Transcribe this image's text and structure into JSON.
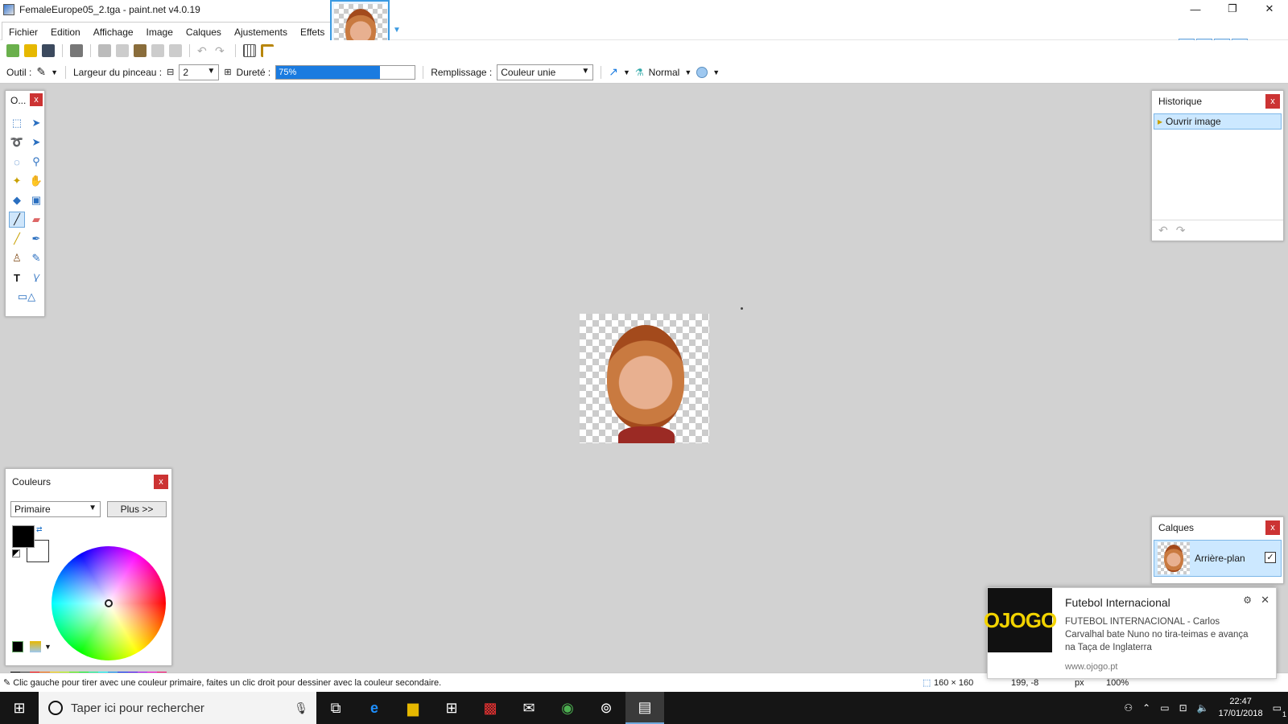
{
  "window": {
    "title": "FemaleEurope05_2.tga - paint.net v4.0.19",
    "minimize": "—",
    "restore": "❐",
    "close": "✕"
  },
  "menu": [
    "Fichier",
    "Edition",
    "Affichage",
    "Image",
    "Calques",
    "Ajustements",
    "Effets"
  ],
  "toolbar2": {
    "tool_label": "Outil :",
    "brush_width_label": "Largeur du pinceau :",
    "brush_width_value": "2",
    "hardness_label": "Dureté :",
    "hardness_value": "75%",
    "hardness_fraction": 0.75,
    "fill_label": "Remplissage :",
    "fill_value": "Couleur unie",
    "blend_mode": "Normal"
  },
  "tools_panel": {
    "title": "O...",
    "close": "x"
  },
  "history": {
    "title": "Historique",
    "close": "x",
    "items": [
      "Ouvrir image"
    ]
  },
  "layers": {
    "title": "Calques",
    "close": "x",
    "items": [
      {
        "name": "Arrière-plan",
        "visible_check": "✓"
      }
    ]
  },
  "colors": {
    "title": "Couleurs",
    "close": "x",
    "mode": "Primaire",
    "more_button": "Plus >>"
  },
  "status": {
    "hint": "Clic gauche pour tirer avec une couleur primaire, faites un clic droit pour dessiner avec la couleur secondaire.",
    "image_size": "160 × 160",
    "cursor_pos": "199, -8",
    "units": "px",
    "zoom": "100%"
  },
  "toast": {
    "logo": "OJOGO",
    "title": "Futebol Internacional",
    "body": "FUTEBOL INTERNACIONAL - Carlos Carvalhal bate Nuno no tira-teimas e avança na Taça de Inglaterra",
    "source": "www.ojogo.pt",
    "settings": "⚙",
    "close": "✕"
  },
  "taskbar": {
    "search_placeholder": "Taper ici pour rechercher",
    "time": "22:47",
    "date": "17/01/2018",
    "notification_count": "1"
  },
  "accent_color": "#1a7be0"
}
